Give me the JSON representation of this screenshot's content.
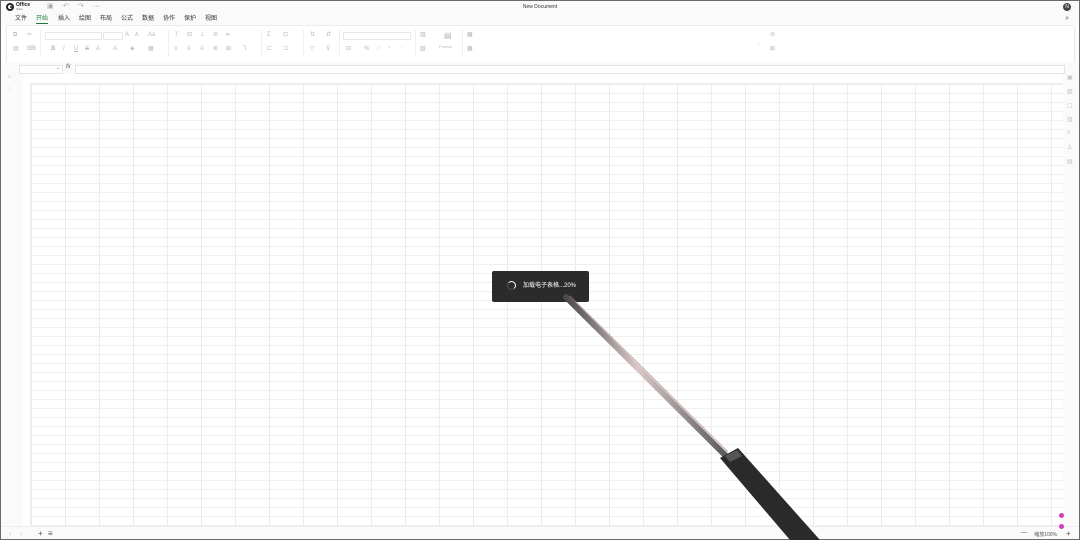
{
  "app": {
    "logo_text": "Office",
    "logo_sub": "Suite",
    "document_title": "New Document",
    "avatar_initial": "N"
  },
  "menu": {
    "tabs": [
      {
        "label": "文件"
      },
      {
        "label": "开始",
        "active": true
      },
      {
        "label": "插入"
      },
      {
        "label": "绘图"
      },
      {
        "label": "布局"
      },
      {
        "label": "公式"
      },
      {
        "label": "数据"
      },
      {
        "label": "协作"
      },
      {
        "label": "保护"
      },
      {
        "label": "视图"
      }
    ]
  },
  "ribbon": {
    "font_size_ticks": "A",
    "format_label": "Format",
    "percent_symbol": "%"
  },
  "formula_bar": {
    "fx_label": "fx",
    "name_box_value": "",
    "formula_value": ""
  },
  "loading": {
    "message": "加载电子表格...",
    "percent": "20%",
    "progress_value": 20
  },
  "bottom": {
    "add_sheet": "+",
    "list_sheets": "≡",
    "zoom_out": "—",
    "zoom_label": "缩放100%",
    "zoom_in": "+"
  },
  "colors": {
    "accent": "#1f7a3a",
    "loader_bg": "#2b2b2b",
    "pen_tip": "#d43dbc"
  },
  "icons": {
    "undo": "undo-icon",
    "redo": "redo-icon",
    "save": "save-icon",
    "search": "search-icon"
  }
}
